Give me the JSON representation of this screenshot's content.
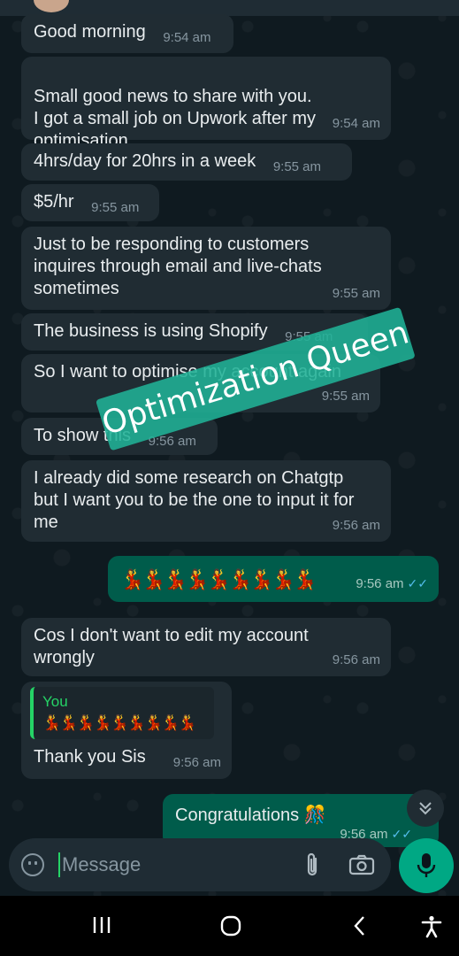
{
  "chat": {
    "messages": [
      {
        "text": "Good morning",
        "time": "9:54 am"
      },
      {
        "text": "Small good news to share with you.\nI got a small job on Upwork after my optimisation.",
        "time": "9:54 am"
      },
      {
        "text": "4hrs/day for 20hrs in a week",
        "time": "9:55 am"
      },
      {
        "text": "$5/hr",
        "time": "9:55 am"
      },
      {
        "text": "Just to be responding to customers inquires through email and live-chats sometimes",
        "time": "9:55 am"
      },
      {
        "text": "The business is using Shopify",
        "time": "9:55 am"
      },
      {
        "text": "So I want to optimise my account again",
        "time": "9:55 am"
      },
      {
        "text": "To show this",
        "time": "9:56 am"
      },
      {
        "text": "I already did some research on Chatgtp but I want you to be the one to input it for me",
        "time": "9:56 am"
      },
      {
        "emoji": "💃💃💃💃💃💃💃💃💃",
        "time": "9:56 am"
      },
      {
        "text": "Cos I don't want to edit my account wrongly",
        "time": "9:56 am"
      },
      {
        "reply_name": "You",
        "reply_emoji": "💃💃💃💃💃💃💃💃💃",
        "text": "Thank you Sis",
        "time": "9:56 am"
      },
      {
        "text": "Congratulations 🎊",
        "time": "9:56 am"
      }
    ]
  },
  "watermark": "Optimization Queen",
  "input": {
    "placeholder": "Message"
  },
  "colors": {
    "incoming_bubble": "#202c33",
    "outgoing_bubble": "#005c4b",
    "accent": "#00a884",
    "read_ticks": "#53bdeb"
  },
  "icons": [
    "emoji-icon",
    "attach-icon",
    "camera-icon",
    "mic-icon",
    "scroll-down-icon",
    "recents-icon",
    "home-icon",
    "back-icon",
    "accessibility-icon"
  ]
}
